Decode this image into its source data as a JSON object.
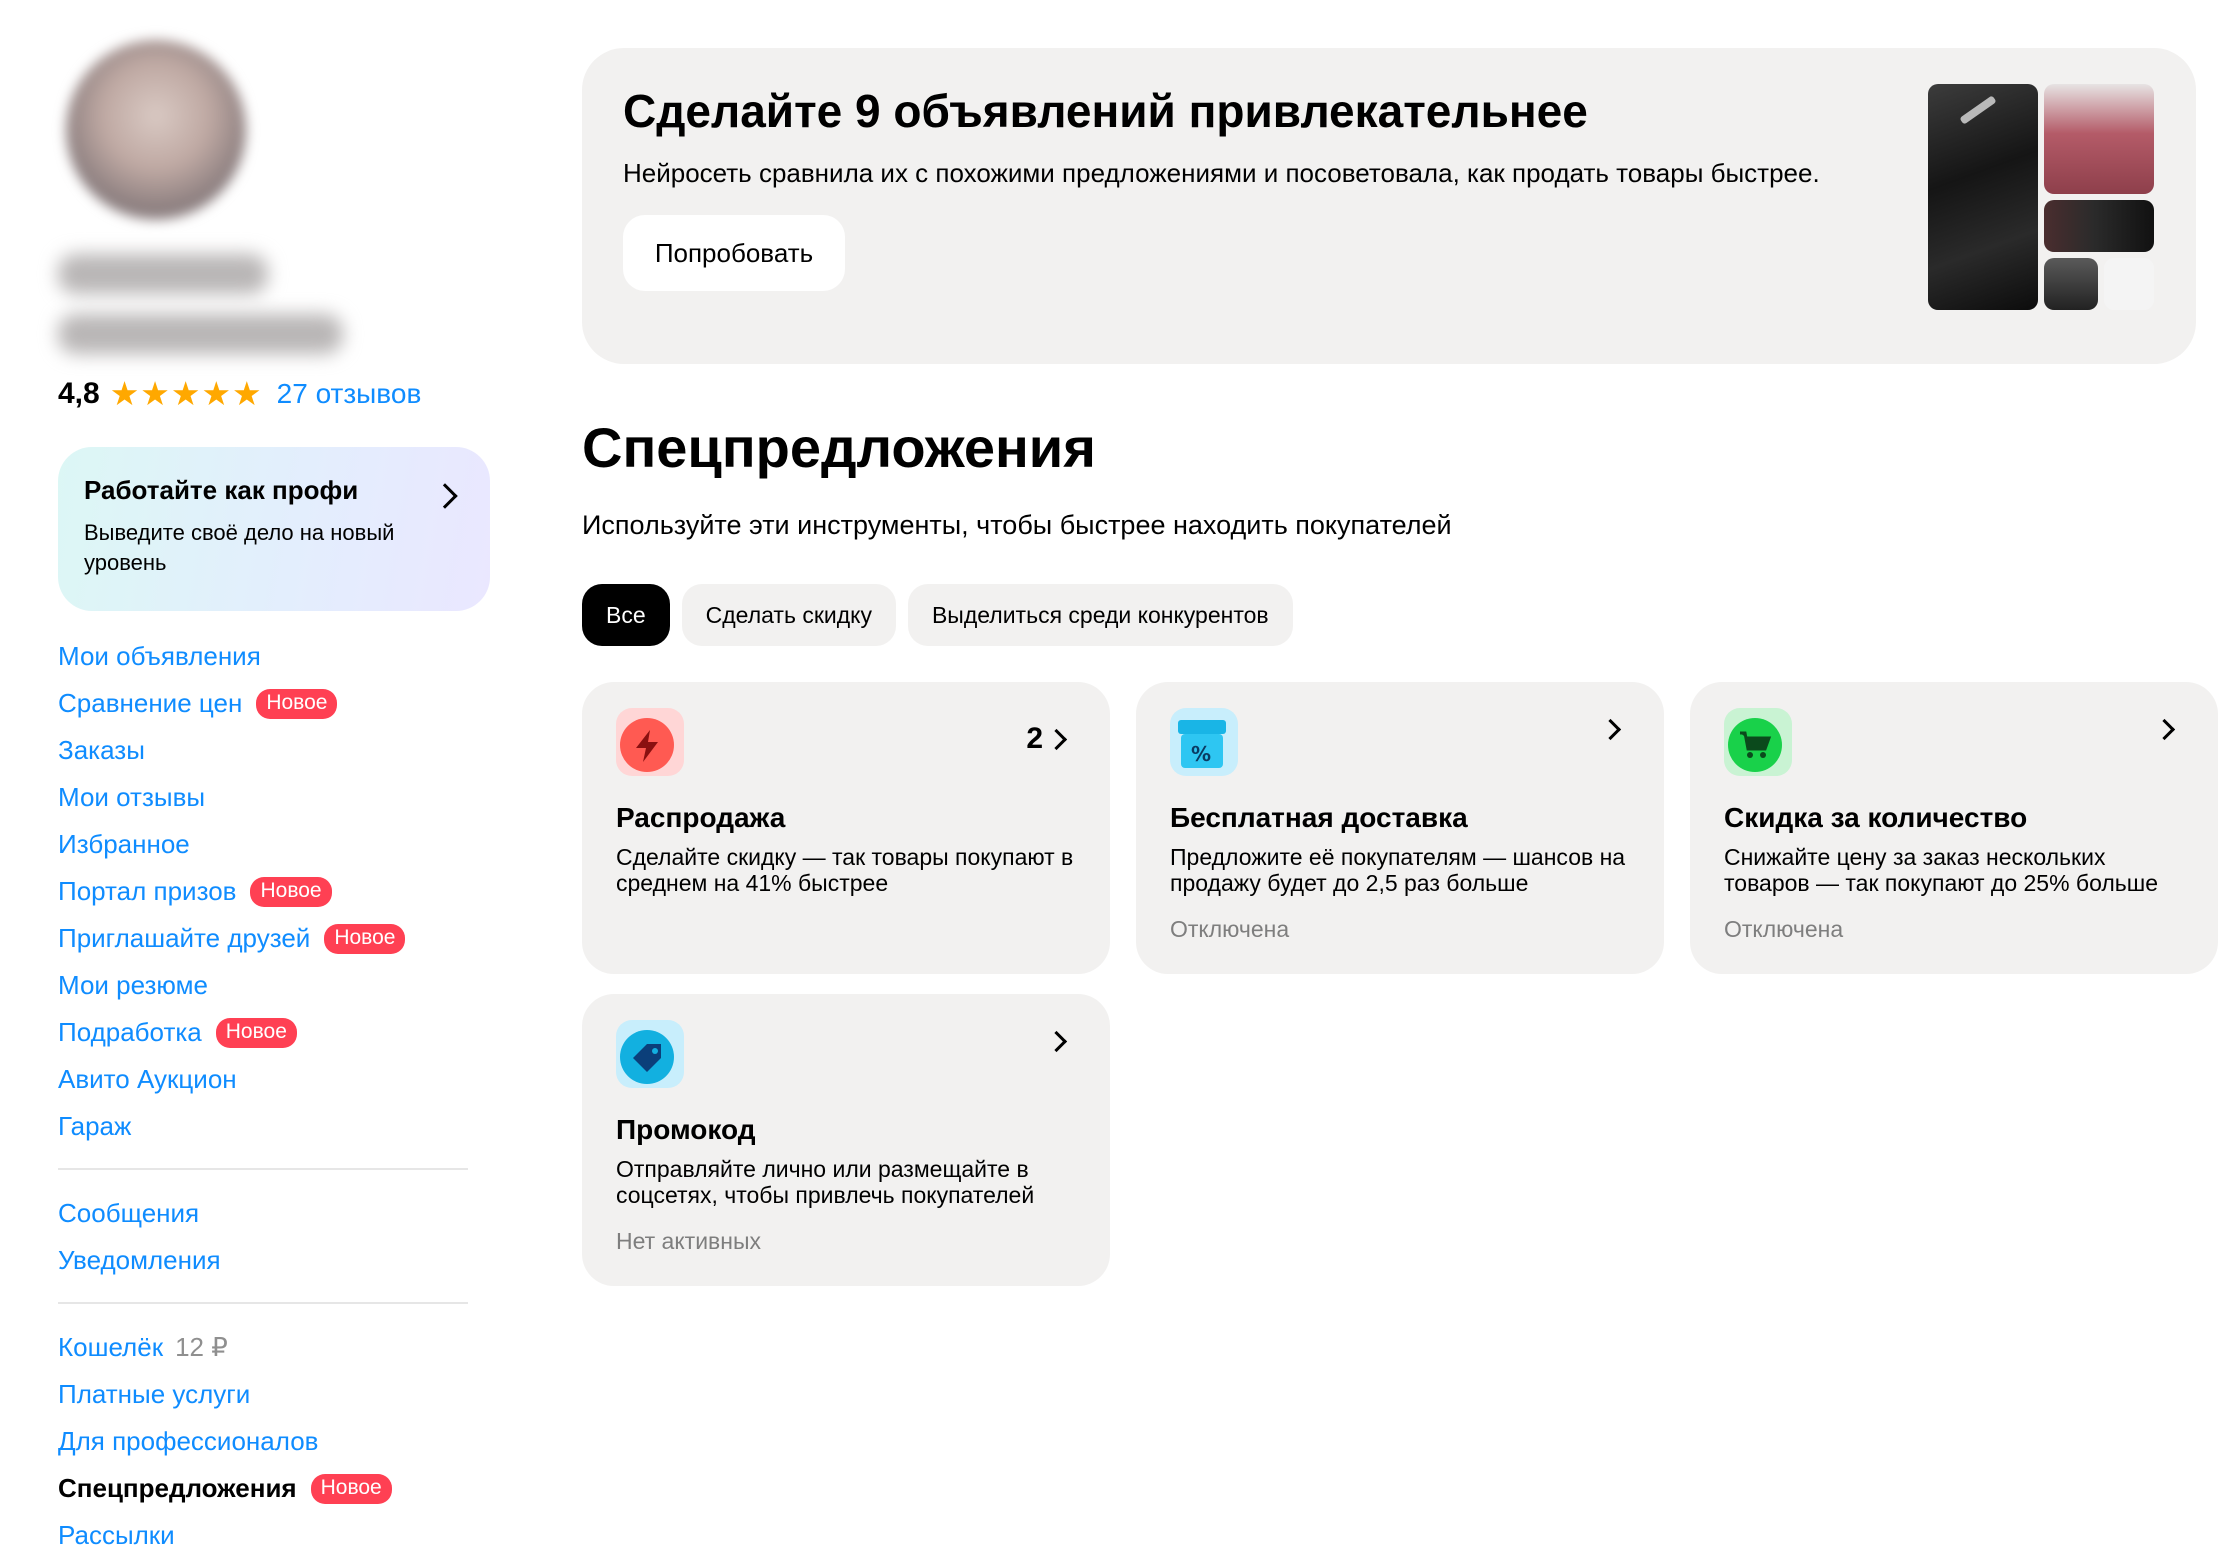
{
  "sidebar": {
    "rating": "4,8",
    "stars": "★★★★★",
    "reviews": "27 отзывов",
    "pro_card": {
      "title": "Работайте как профи",
      "subtitle": "Выведите своё дело на новый уровень"
    },
    "badge_new": "Новое",
    "nav_group1": [
      {
        "label": "Мои объявления"
      },
      {
        "label": "Сравнение цен",
        "badge": "Новое"
      },
      {
        "label": "Заказы"
      },
      {
        "label": "Мои отзывы"
      },
      {
        "label": "Избранное"
      },
      {
        "label": "Портал призов",
        "badge": "Новое"
      },
      {
        "label": "Приглашайте друзей",
        "badge": "Новое"
      },
      {
        "label": "Мои резюме"
      },
      {
        "label": "Подработка",
        "badge": "Новое"
      },
      {
        "label": "Авито Аукцион"
      },
      {
        "label": "Гараж"
      }
    ],
    "nav_group2": [
      {
        "label": "Сообщения"
      },
      {
        "label": "Уведомления"
      }
    ],
    "nav_group3": [
      {
        "label": "Кошелёк",
        "suffix": "12 ₽"
      },
      {
        "label": "Платные услуги"
      },
      {
        "label": "Для профессионалов"
      },
      {
        "label": "Спецпредложения",
        "badge": "Новое",
        "active": true
      },
      {
        "label": "Рассылки"
      }
    ]
  },
  "banner": {
    "title": "Сделайте 9 объявлений привлекательнее",
    "text": "Нейросеть сравнила их с похожими предложениями и посоветовала, как продать товары быстрее.",
    "button": "Попробовать"
  },
  "main": {
    "title": "Спецпредложения",
    "subtitle": "Используйте эти инструменты, чтобы быстрее находить покупателей",
    "chips": [
      "Все",
      "Сделать скидку",
      "Выделиться среди конкурентов"
    ],
    "cards": [
      {
        "title": "Распродажа",
        "text": "Сделайте скидку — так товары покупают в среднем на 41% быстрее",
        "status": "",
        "count": "2",
        "icon": "lightning-icon"
      },
      {
        "title": "Бесплатная доставка",
        "text": "Предложите её покупателям — шансов на продажу будет до 2,5 раз больше",
        "status": "Отключена",
        "count": "",
        "icon": "delivery-box-icon"
      },
      {
        "title": "Скидка за количество",
        "text": "Снижайте цену за заказ нескольких товаров — так покупают до 25% больше",
        "status": "Отключена",
        "count": "",
        "icon": "cart-icon"
      },
      {
        "title": "Промокод",
        "text": "Отправляйте лично или размещайте в соцсетях, чтобы привлечь покупателей",
        "status": "Нет активных",
        "count": "",
        "icon": "tag-icon"
      }
    ]
  },
  "colors": {
    "link": "#0f8cff",
    "badge": "#ff4053",
    "card_bg": "#f2f1f0",
    "star": "#ffa800"
  }
}
